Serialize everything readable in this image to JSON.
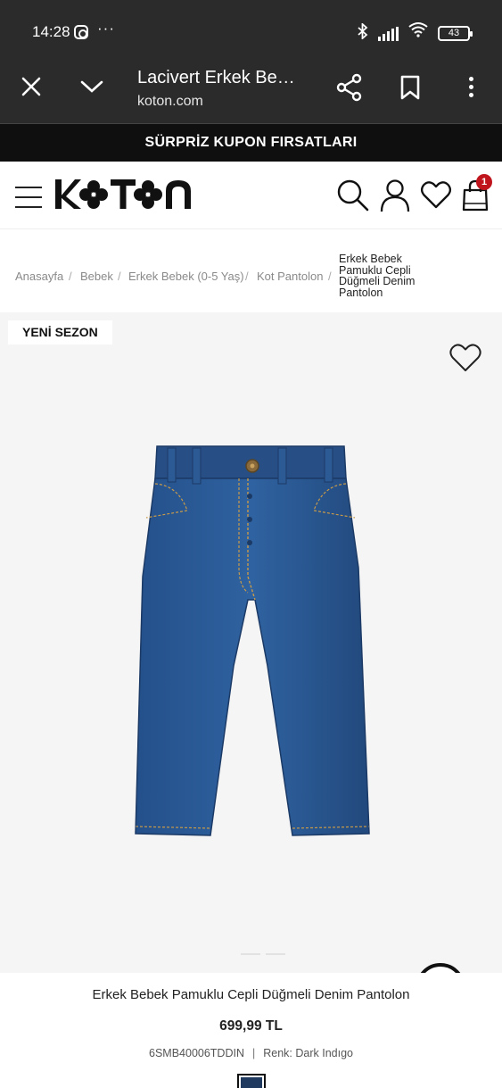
{
  "status_bar": {
    "time": "14:28",
    "more": "···",
    "battery": "43",
    "icons": [
      "instagram-icon",
      "bluetooth-icon",
      "signal-icon",
      "wifi-icon",
      "battery-icon"
    ]
  },
  "browser": {
    "title": "Lacivert Erkek Bebek Pamuklu Cepli Düğmeli Denim Pantolon",
    "url": "koton.com",
    "icons": [
      "close-icon",
      "chevron-down-icon",
      "share-icon",
      "bookmark-icon",
      "more-vertical-icon"
    ]
  },
  "promo": {
    "text": "SÜRPRİZ KUPON FIRSATLARI"
  },
  "header": {
    "logo": "KOTON",
    "cart_count": "1",
    "icons": [
      "hamburger-icon",
      "search-icon",
      "user-icon",
      "heart-icon",
      "shopping-bag-icon"
    ]
  },
  "breadcrumb": {
    "items": [
      "Anasayfa",
      "Bebek",
      "Erkek Bebek (0-5 Yaş)",
      "Kot Pantolon"
    ],
    "separator": "/",
    "current": "Erkek Bebek Pamuklu Cepli Düğmeli Denim Pantolon"
  },
  "product": {
    "badge": "YENİ SEZON",
    "name": "Erkek Bebek Pamuklu Cepli Düğmeli Denim Pantolon",
    "price": "699,99 TL",
    "sku": "6SMB40006TDDIN",
    "meta_separator": "|",
    "color_label": "Renk: Dark Indıgo",
    "swatch_color": "#1f3a5e",
    "image_subject": "denim-jeans-image"
  },
  "colors": {
    "status_bg": "#2b2b2b",
    "promo_bg": "#0f0f0f",
    "badge_red": "#c0151d",
    "image_bg": "#f5f5f5",
    "denim": "#2a5a93"
  }
}
